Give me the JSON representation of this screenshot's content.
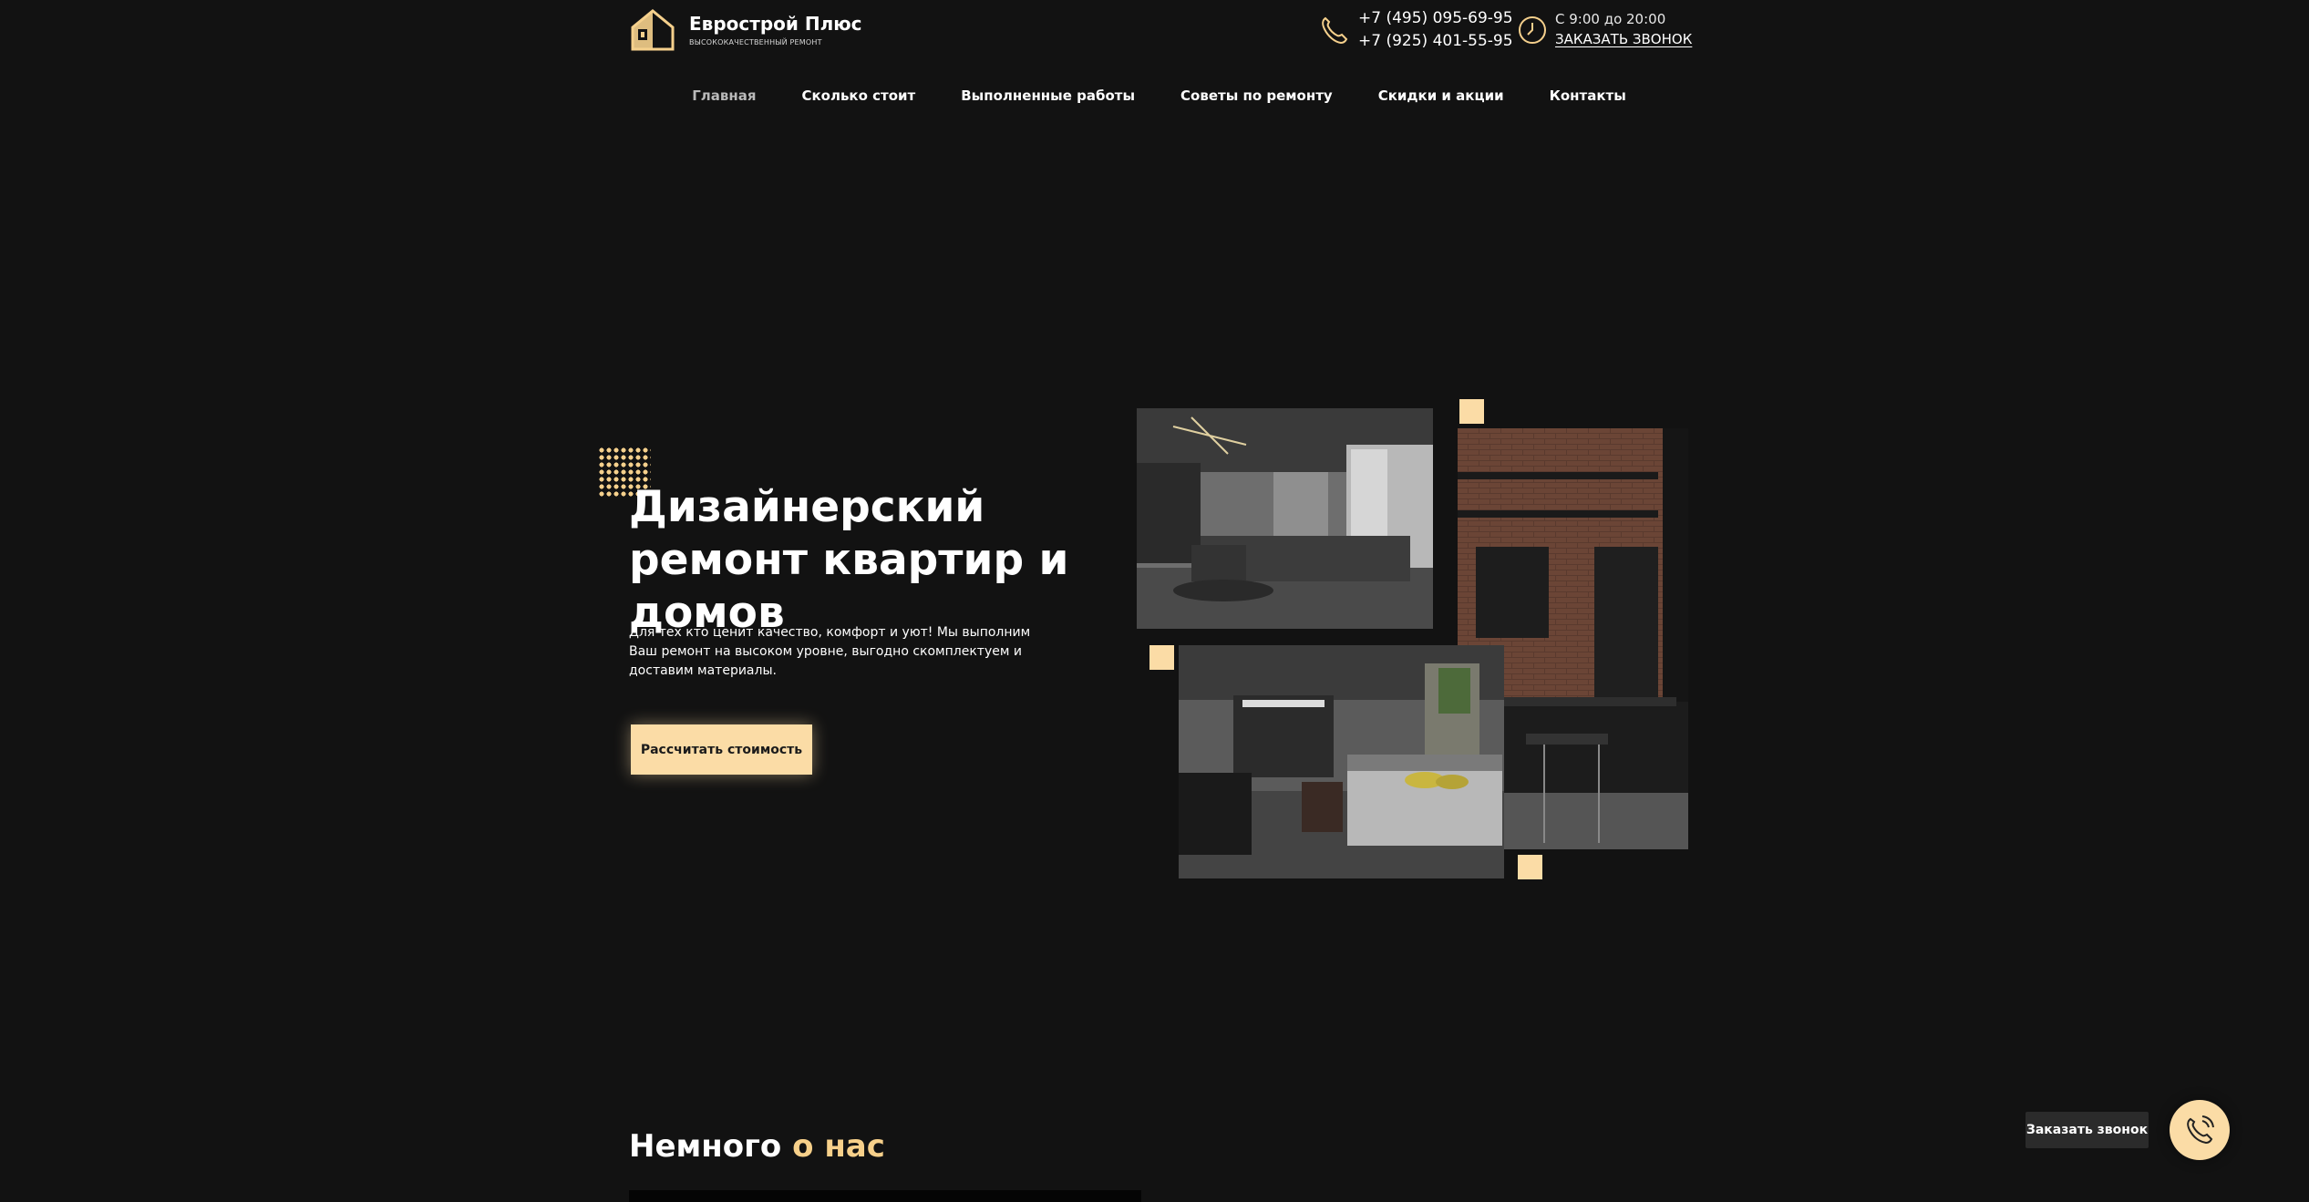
{
  "header": {
    "brand_name": "Еврострой Плюс",
    "brand_tagline": "ВЫСОКОКАЧЕСТВЕННЫЙ РЕМОНТ",
    "phone_1": "+7 (495) 095-69-95",
    "phone_2": "+7 (925) 401-55-95",
    "hours": "С 9:00 до 20:00",
    "callback_link": "ЗАКАЗАТЬ ЗВОНОК",
    "icons": [
      "house-logo-icon",
      "phone-icon",
      "clock-icon"
    ]
  },
  "nav": {
    "items": [
      {
        "label": "Главная",
        "active": true
      },
      {
        "label": "Сколько стоит"
      },
      {
        "label": "Выполненные работы"
      },
      {
        "label": "Советы по ремонту"
      },
      {
        "label": "Скидки и акции"
      },
      {
        "label": "Контакты"
      }
    ]
  },
  "hero": {
    "title": "Дизайнерский ремонт квартир и домов",
    "description": "Для тех кто ценит качество, комфорт и уют! Мы выполним Ваш ремонт на высоком уровне, выгодно скомплектуем и доставим материалы.",
    "cta_label": "Рассчитать стоимость"
  },
  "about": {
    "title_plain": "Немного ",
    "title_accent": "о нас"
  },
  "floating_callback": {
    "label": "Заказать звонок",
    "icon": "phone-ring-icon"
  },
  "colors": {
    "background": "#121212",
    "accent": "#fbdca6",
    "accent_text": "#f7d08a"
  }
}
